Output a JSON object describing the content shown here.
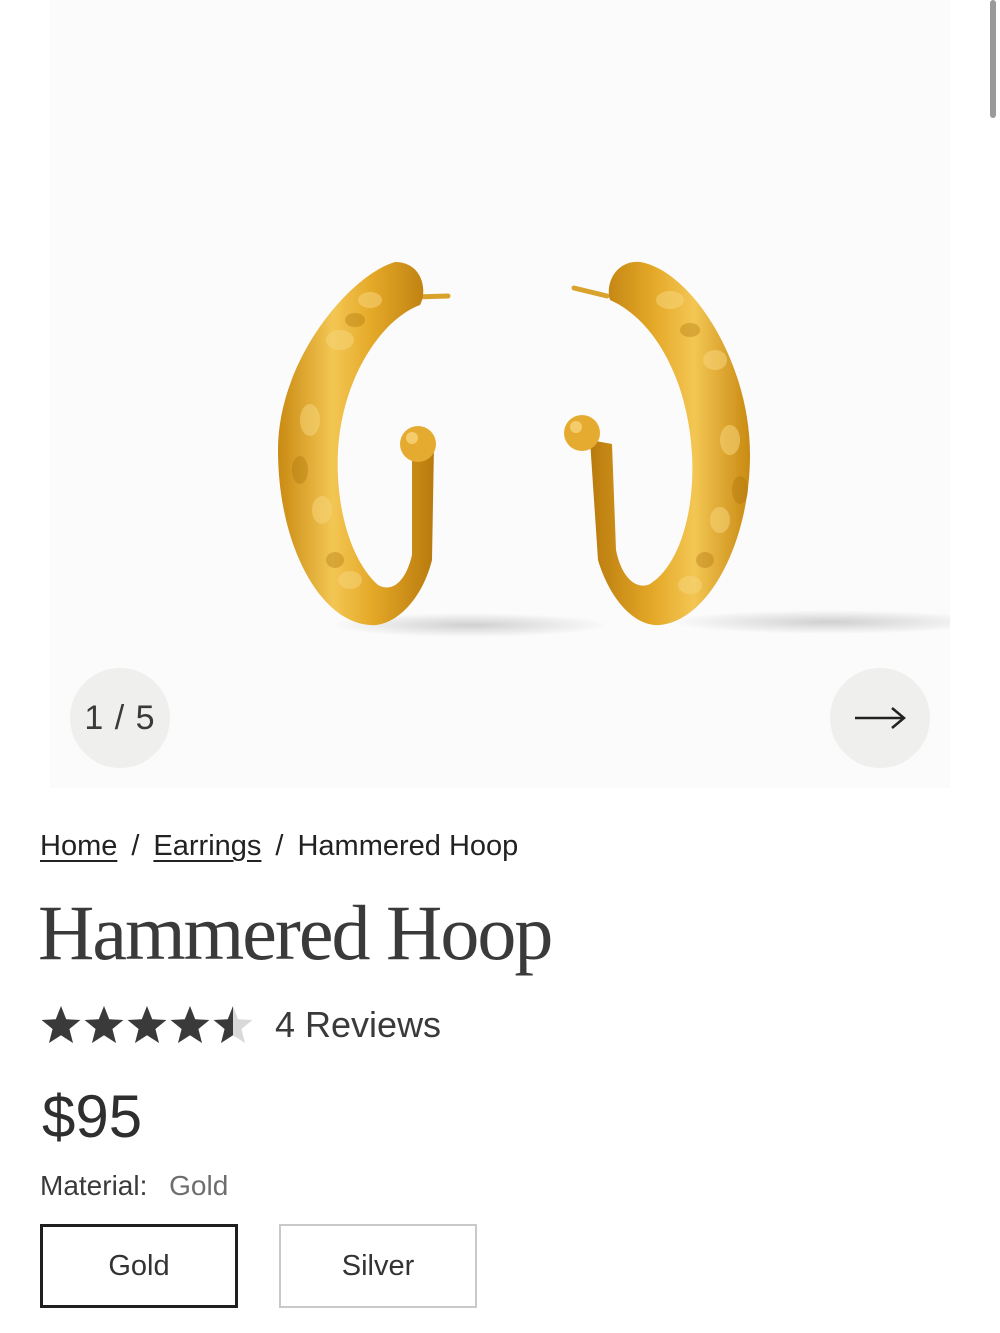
{
  "gallery": {
    "counter": "1 / 5",
    "image_alt": "Hammered Hoop gold earrings",
    "icons": {
      "next": "arrow-right-icon"
    }
  },
  "breadcrumb": {
    "home": "Home",
    "category": "Earrings",
    "current": "Hammered Hoop",
    "separator": "/"
  },
  "product": {
    "title": "Hammered Hoop",
    "rating": 4.5,
    "rating_max": 5,
    "reviews_label": "4 Reviews",
    "price": "$95",
    "material_label": "Material:",
    "material_value": "Gold",
    "options": [
      "Gold",
      "Silver"
    ],
    "selected_option": "Gold"
  },
  "colors": {
    "gold": "#e8b33a",
    "star": "#3a3a3a",
    "star_empty": "#d9d9d9",
    "badge_bg": "#efefed"
  }
}
